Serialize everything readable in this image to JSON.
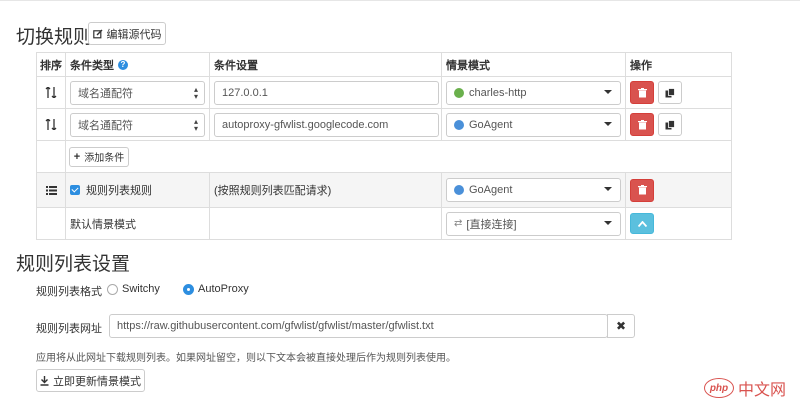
{
  "section_switch": {
    "title": "切换规则",
    "edit_source_label": "编辑源代码"
  },
  "table": {
    "headers": {
      "order": "排序",
      "condition_type": "条件类型",
      "condition_setting": "条件设置",
      "profile": "情景模式",
      "actions": "操作"
    },
    "rules": [
      {
        "type": "域名通配符",
        "value": "127.0.0.1",
        "profile": "charles-http",
        "profile_color": "#6ab04c"
      },
      {
        "type": "域名通配符",
        "value": "autoproxy-gfwlist.googlecode.com",
        "profile": "GoAgent",
        "profile_color": "#4a90d9"
      }
    ],
    "add_condition_label": "添加条件",
    "rule_list": {
      "label": "规则列表规则",
      "setting": "(按照规则列表匹配请求)",
      "profile": "GoAgent",
      "profile_color": "#4a90d9",
      "checked": true
    },
    "default": {
      "label": "默认情景模式",
      "profile": "[直接连接]"
    }
  },
  "section_ruleset": {
    "title": "规则列表设置",
    "format_label": "规则列表格式",
    "format_options": [
      "Switchy",
      "AutoProxy"
    ],
    "format_selected": "AutoProxy",
    "url_label": "规则列表网址",
    "url_value": "https://raw.githubusercontent.com/gfwlist/gfwlist/master/gfwlist.txt",
    "hint": "应用将从此网址下载规则列表。如果网址留空，则以下文本会被直接处理后作为规则列表使用。",
    "update_label": "立即更新情景模式"
  },
  "watermark": {
    "logo": "php",
    "text": "中文网"
  },
  "colors": {
    "danger": "#d9534f",
    "info": "#5bc0de",
    "primary": "#2d8ee0"
  }
}
